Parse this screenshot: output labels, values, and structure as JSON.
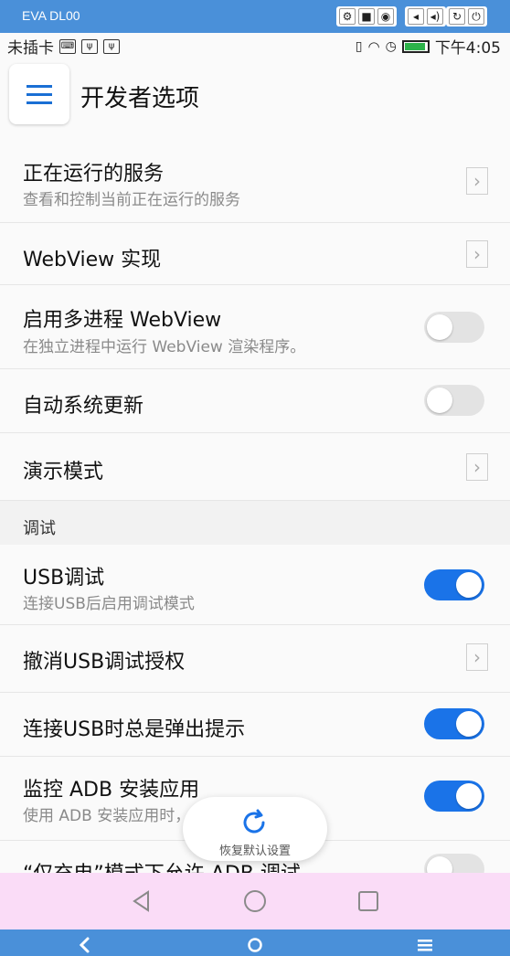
{
  "emulator": {
    "title": "EVA DL00",
    "controls": [
      "gear-icon",
      "video-icon",
      "camera-icon",
      "volume-down-icon",
      "volume-up-icon",
      "rotate-icon",
      "power-icon"
    ]
  },
  "status_bar": {
    "carrier": "未插卡",
    "time": "下午4:05",
    "battery_level": 0.85
  },
  "toolbar": {
    "title": "开发者选项"
  },
  "rows": [
    {
      "id": "running-services",
      "title": "正在运行的服务",
      "subtitle": "查看和控制当前正在运行的服务",
      "control": "chevron"
    },
    {
      "id": "webview-impl",
      "title": "WebView 实现",
      "subtitle": "",
      "control": "chevron"
    },
    {
      "id": "webview-multiprocess",
      "title": "启用多进程 WebView",
      "subtitle": "在独立进程中运行 WebView 渲染程序。",
      "control": "toggle",
      "on": false
    },
    {
      "id": "auto-system-update",
      "title": "自动系统更新",
      "subtitle": "",
      "control": "toggle",
      "on": false
    },
    {
      "id": "demo-mode",
      "title": "演示模式",
      "subtitle": "",
      "control": "chevron"
    }
  ],
  "section": {
    "debug_label": "调试"
  },
  "debug_rows": [
    {
      "id": "usb-debugging",
      "title": "USB调试",
      "subtitle": "连接USB后启用调试模式",
      "control": "toggle",
      "on": true
    },
    {
      "id": "revoke-usb-auth",
      "title": "撤消USB调试授权",
      "subtitle": "",
      "control": "chevron"
    },
    {
      "id": "usb-prompt",
      "title": "连接USB时总是弹出提示",
      "subtitle": "",
      "control": "toggle",
      "on": true
    },
    {
      "id": "adb-install-monitor",
      "title": "监控 ADB 安装应用",
      "subtitle": "使用 ADB 安装应用时，需要二次确认",
      "control": "toggle",
      "on": true
    },
    {
      "id": "charge-only-adb",
      "title": "“仅充电”模式下允许 ADB 调试",
      "subtitle": "",
      "control": "toggle",
      "on": false
    }
  ],
  "restore": {
    "label": "恢复默认设置"
  },
  "colors": {
    "accent": "#1a73e8",
    "emulator_bar": "#4a90d9"
  }
}
